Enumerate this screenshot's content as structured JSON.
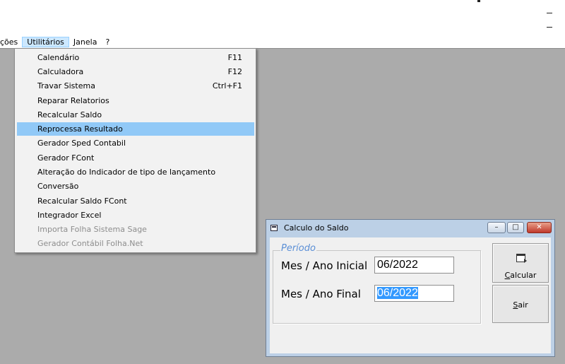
{
  "menubar": {
    "items": [
      {
        "label": "ções"
      },
      {
        "label": "Utilitários"
      },
      {
        "label": "Janela"
      },
      {
        "label": "?"
      }
    ]
  },
  "dropdown": {
    "items": [
      {
        "label": "Calendário",
        "shortcut": "F11"
      },
      {
        "label": "Calculadora",
        "shortcut": "F12"
      },
      {
        "label": "Travar Sistema",
        "shortcut": "Ctrl+F1"
      },
      {
        "label": "Reparar Relatorios",
        "shortcut": ""
      },
      {
        "label": "Recalcular Saldo",
        "shortcut": ""
      },
      {
        "label": "Reprocessa Resultado",
        "shortcut": ""
      },
      {
        "label": "Gerador Sped Contabil",
        "shortcut": ""
      },
      {
        "label": "Gerador FCont",
        "shortcut": ""
      },
      {
        "label": "Alteração do Indicador de tipo de lançamento",
        "shortcut": ""
      },
      {
        "label": "Conversão",
        "shortcut": ""
      },
      {
        "label": "Recalcular Saldo FCont",
        "shortcut": ""
      },
      {
        "label": "Integrador Excel",
        "shortcut": ""
      },
      {
        "label": "Importa Folha Sistema Sage",
        "shortcut": ""
      },
      {
        "label": "Gerador Contábil Folha.Net",
        "shortcut": ""
      }
    ],
    "highlighted_index": 5,
    "disabled_indices": [
      12,
      13
    ]
  },
  "dialog": {
    "title": "Calculo do Saldo",
    "controls": {
      "minimize": "–",
      "maximize": "□",
      "close": "✕"
    },
    "group_label": "Período",
    "start_label": "Mes / Ano Inicial",
    "start_value": "06/2022",
    "end_label": "Mes / Ano Final",
    "end_value": "06/2022",
    "calc_button": {
      "accel": "C",
      "rest": "alcular"
    },
    "exit_button": {
      "accel": "S",
      "rest": "air"
    }
  },
  "colors": {
    "workspace": "#ababab",
    "menu_highlight": "#91c9f7",
    "selection": "#3399ff",
    "group_label": "#5b8fd6"
  }
}
